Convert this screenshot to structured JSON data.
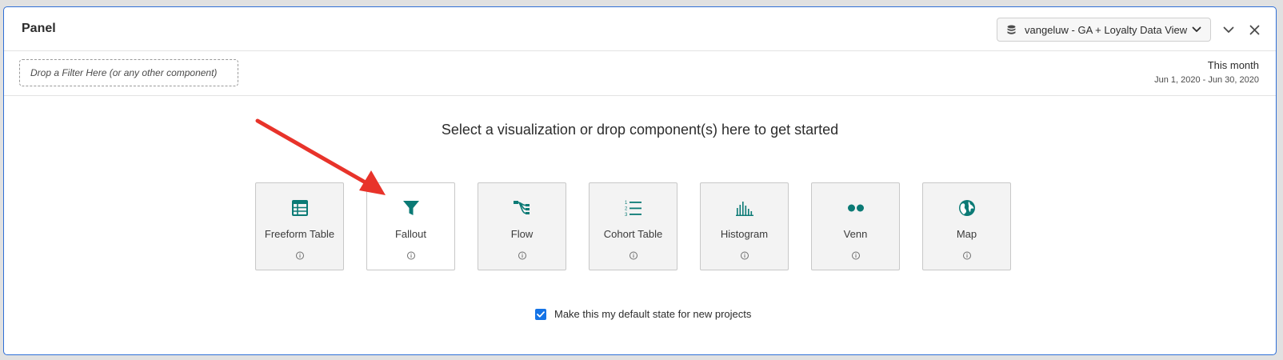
{
  "colors": {
    "accent": "#1473e6",
    "icon_teal": "#0b7a75",
    "arrow_red": "#e8332a",
    "panel_border": "#2f6fd6"
  },
  "panel": {
    "title": "Panel",
    "data_view": {
      "icon": "database-icon",
      "label": "vangeluw - GA + Loyalty Data View"
    },
    "header_buttons": [
      {
        "icon": "chevron-down-icon"
      },
      {
        "icon": "close-icon"
      }
    ]
  },
  "filter_bar": {
    "drop_zone_text": "Drop a Filter Here (or any other component)",
    "date_range": {
      "name": "This month",
      "dates": "Jun 1, 2020 - Jun 30, 2020"
    }
  },
  "main": {
    "prompt": "Select a visualization or drop component(s) here to get started",
    "visualizations": [
      {
        "label": "Freeform Table",
        "icon": "table-icon"
      },
      {
        "label": "Fallout",
        "icon": "funnel-icon"
      },
      {
        "label": "Flow",
        "icon": "flow-icon"
      },
      {
        "label": "Cohort Table",
        "icon": "numbered-list-icon"
      },
      {
        "label": "Histogram",
        "icon": "histogram-icon"
      },
      {
        "label": "Venn",
        "icon": "venn-icon"
      },
      {
        "label": "Map",
        "icon": "globe-icon"
      }
    ],
    "default_state": {
      "checked": true,
      "label": "Make this my default state for new projects"
    }
  }
}
